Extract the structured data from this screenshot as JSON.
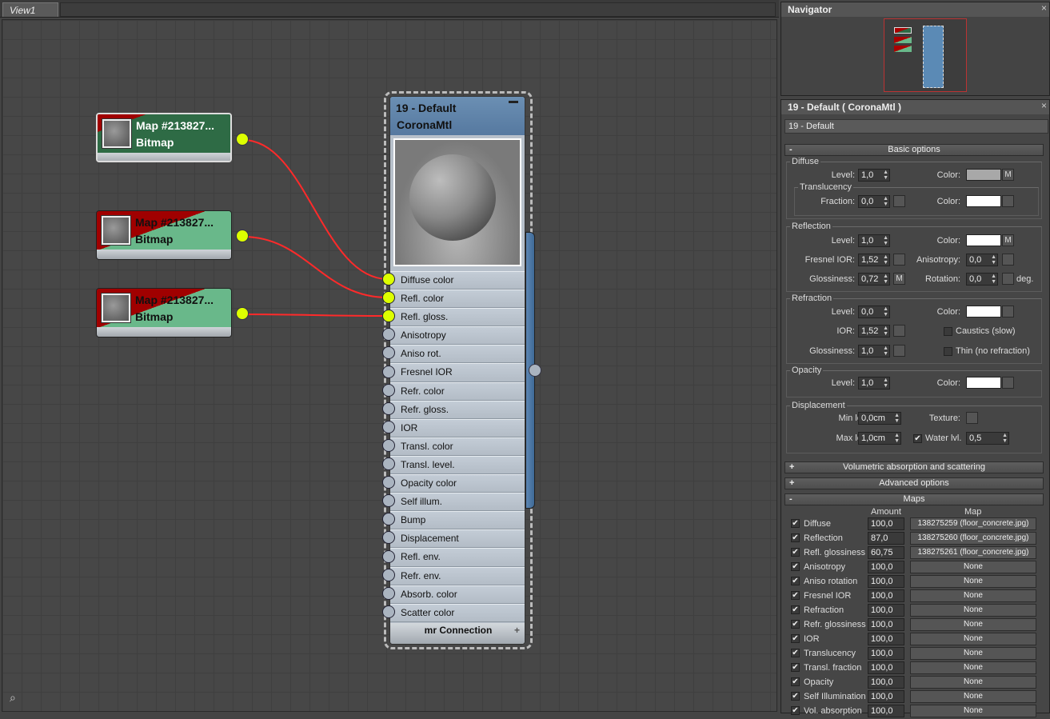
{
  "view": {
    "tab_label": "View1"
  },
  "bitmap_nodes": [
    {
      "title": "Map #213827...",
      "type": "Bitmap"
    },
    {
      "title": "Map #213827...",
      "type": "Bitmap"
    },
    {
      "title": "Map #213827...",
      "type": "Bitmap"
    }
  ],
  "material_node": {
    "title_line1": "19 - Default",
    "title_line2": "CoronaMtl",
    "ports": [
      "Diffuse color",
      "Refl. color",
      "Refl. gloss.",
      "Anisotropy",
      "Aniso rot.",
      "Fresnel IOR",
      "Refr. color",
      "Refr. gloss.",
      "IOR",
      "Transl. color",
      "Transl. level.",
      "Opacity color",
      "Self illum.",
      "Bump",
      "Displacement",
      "Refl. env.",
      "Refr. env.",
      "Absorb. color",
      "Scatter color"
    ],
    "footer": "mr Connection"
  },
  "navigator": {
    "title": "Navigator"
  },
  "material_panel": {
    "title": "19 - Default  ( CoronaMtl )",
    "name": "19 - Default",
    "basic_options": "Basic options",
    "diffuse": {
      "label": "Diffuse",
      "level_label": "Level:",
      "level": "1,0",
      "color_label": "Color:",
      "map_btn": "M"
    },
    "translucency": {
      "label": "Translucency",
      "fraction_label": "Fraction:",
      "fraction": "0,0",
      "color_label": "Color:"
    },
    "reflection": {
      "label": "Reflection",
      "level_label": "Level:",
      "level": "1,0",
      "color_label": "Color:",
      "map_btn": "M",
      "fresnel_label": "Fresnel IOR:",
      "fresnel": "1,52",
      "aniso_label": "Anisotropy:",
      "aniso": "0,0",
      "gloss_label": "Glossiness:",
      "gloss": "0,72",
      "gloss_btn": "M",
      "rot_label": "Rotation:",
      "rot": "0,0",
      "deg": "deg."
    },
    "refraction": {
      "label": "Refraction",
      "level_label": "Level:",
      "level": "0,0",
      "color_label": "Color:",
      "ior_label": "IOR:",
      "ior": "1,52",
      "caustics": "Caustics (slow)",
      "gloss_label": "Glossiness:",
      "gloss": "1,0",
      "thin": "Thin (no refraction)"
    },
    "opacity": {
      "label": "Opacity",
      "level_label": "Level:",
      "level": "1,0",
      "color_label": "Color:"
    },
    "displacement": {
      "label": "Displacement",
      "min_label": "Min level:",
      "min": "0,0cm",
      "texture_label": "Texture:",
      "max_label": "Max level:",
      "max": "1,0cm",
      "water_label": "Water lvl.",
      "water": "0,5"
    },
    "vol_rollout": "Volumetric absorption and scattering",
    "adv_rollout": "Advanced options",
    "maps_rollout": "Maps",
    "maps_amount_header": "Amount",
    "maps_map_header": "Map",
    "maps": [
      {
        "name": "Diffuse",
        "amount": "100,0",
        "map": "138275259 (floor_concrete.jpg)"
      },
      {
        "name": "Reflection",
        "amount": "87,0",
        "map": "138275260 (floor_concrete.jpg)"
      },
      {
        "name": "Refl. glossiness",
        "amount": "60,75",
        "map": "138275261 (floor_concrete.jpg)"
      },
      {
        "name": "Anisotropy",
        "amount": "100,0",
        "map": "None"
      },
      {
        "name": "Aniso rotation",
        "amount": "100,0",
        "map": "None"
      },
      {
        "name": "Fresnel IOR",
        "amount": "100,0",
        "map": "None"
      },
      {
        "name": "Refraction",
        "amount": "100,0",
        "map": "None"
      },
      {
        "name": "Refr. glossiness",
        "amount": "100,0",
        "map": "None"
      },
      {
        "name": "IOR",
        "amount": "100,0",
        "map": "None"
      },
      {
        "name": "Translucency",
        "amount": "100,0",
        "map": "None"
      },
      {
        "name": "Transl. fraction",
        "amount": "100,0",
        "map": "None"
      },
      {
        "name": "Opacity",
        "amount": "100,0",
        "map": "None"
      },
      {
        "name": "Self Illumination",
        "amount": "100,0",
        "map": "None"
      },
      {
        "name": "Vol. absorption",
        "amount": "100,0",
        "map": "None"
      }
    ]
  },
  "colors": {
    "bitmap_selected": "#2e6b45",
    "bitmap_header": "#69b88a",
    "bitmap_red": "#a00000",
    "port_active": "#ddff00",
    "wire": "#ff2a2a",
    "node_header": "#6b8fb3"
  }
}
